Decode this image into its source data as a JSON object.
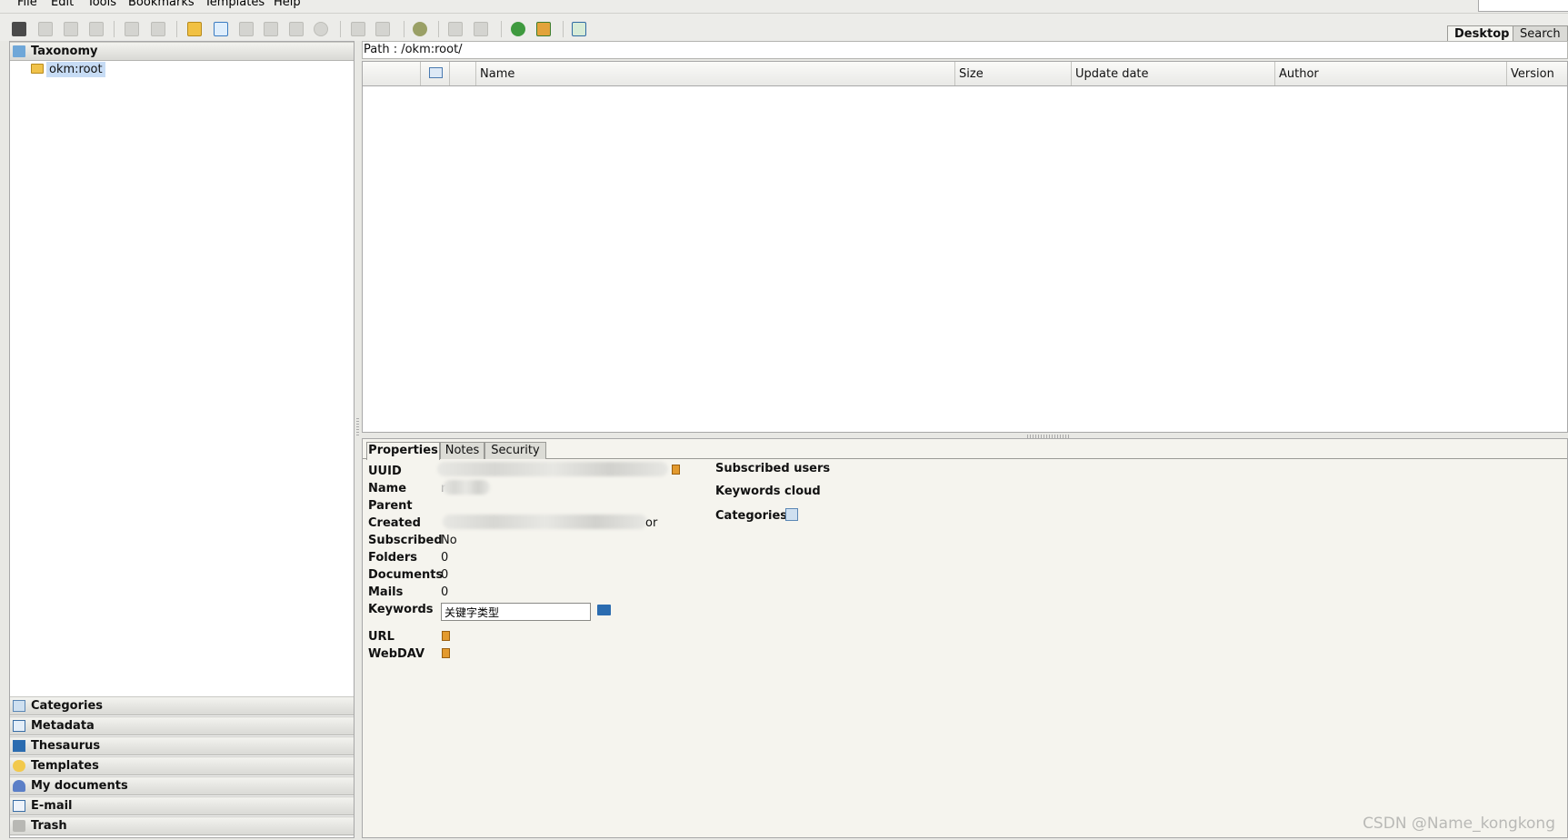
{
  "menu": [
    "File",
    "Edit",
    "Tools",
    "Bookmarks",
    "Templates",
    "Help"
  ],
  "top_tabs": {
    "desktop": "Desktop",
    "search": "Search"
  },
  "left_panel": {
    "taxonomy_label": "Taxonomy",
    "tree_root": "okm:root",
    "stack_items": [
      "Categories",
      "Metadata",
      "Thesaurus",
      "Templates",
      "My documents",
      "E-mail",
      "Trash"
    ]
  },
  "path": "Path : /okm:root/",
  "table_columns": [
    "Name",
    "Size",
    "Update date",
    "Author",
    "Version"
  ],
  "properties": {
    "tabs": [
      "Properties",
      "Notes",
      "Security"
    ],
    "labels": {
      "uuid": "UUID",
      "name": "Name",
      "parent": "Parent",
      "created": "Created",
      "subscribed": "Subscribed",
      "folders": "Folders",
      "documents": "Documents",
      "mails": "Mails",
      "keywords": "Keywords",
      "url": "URL",
      "webdav": "WebDAV"
    },
    "values": {
      "subscribed": "No",
      "folders": "0",
      "documents": "0",
      "mails": "0",
      "keywords": "关键字类型",
      "created_suffix": "or",
      "name_prefix": "r"
    },
    "right_labels": {
      "subscribed_users": "Subscribed users",
      "keywords_cloud": "Keywords cloud",
      "categories": "Categories"
    }
  },
  "watermark": "CSDN @Name_kongkong"
}
